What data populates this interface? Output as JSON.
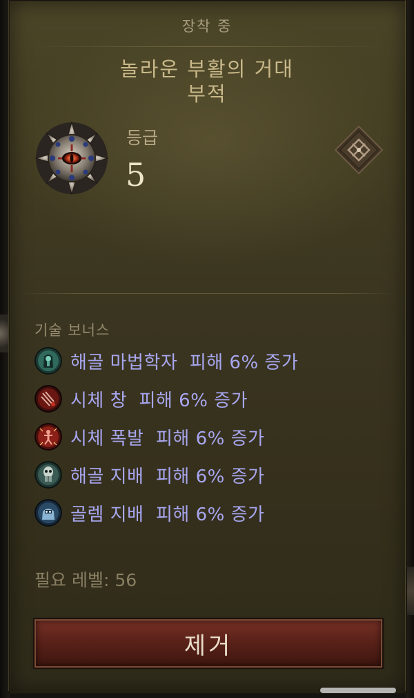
{
  "tooltip": {
    "status_label": "장착 중",
    "item_name_line1": "놀라운 부활의 거대",
    "item_name_line2": "부적",
    "grade_label": "등급",
    "grade_value": "5",
    "item_icon": "amulet-icon",
    "slot_icon": "amulet-slot-icon"
  },
  "skill_bonus": {
    "title": "기술 보너스",
    "items": [
      {
        "text": "해골 마법학자  피해 6% 증가",
        "icon": "skeletal-mage-icon"
      },
      {
        "text": "시체 창  피해 6% 증가",
        "icon": "corpse-lance-icon"
      },
      {
        "text": "시체 폭발  피해 6% 증가",
        "icon": "corpse-explosion-icon"
      },
      {
        "text": "해골 지배  피해 6% 증가",
        "icon": "skeleton-mastery-icon"
      },
      {
        "text": "골렘 지배  피해 6% 증가",
        "icon": "golem-mastery-icon"
      }
    ]
  },
  "requirement": "필요 레벨: 56",
  "remove_button": "제거",
  "colors": {
    "panel": "#3a3520",
    "bonus_text": "#a8a6f0",
    "button": "#5a2219",
    "item_name": "#c9b98a"
  }
}
